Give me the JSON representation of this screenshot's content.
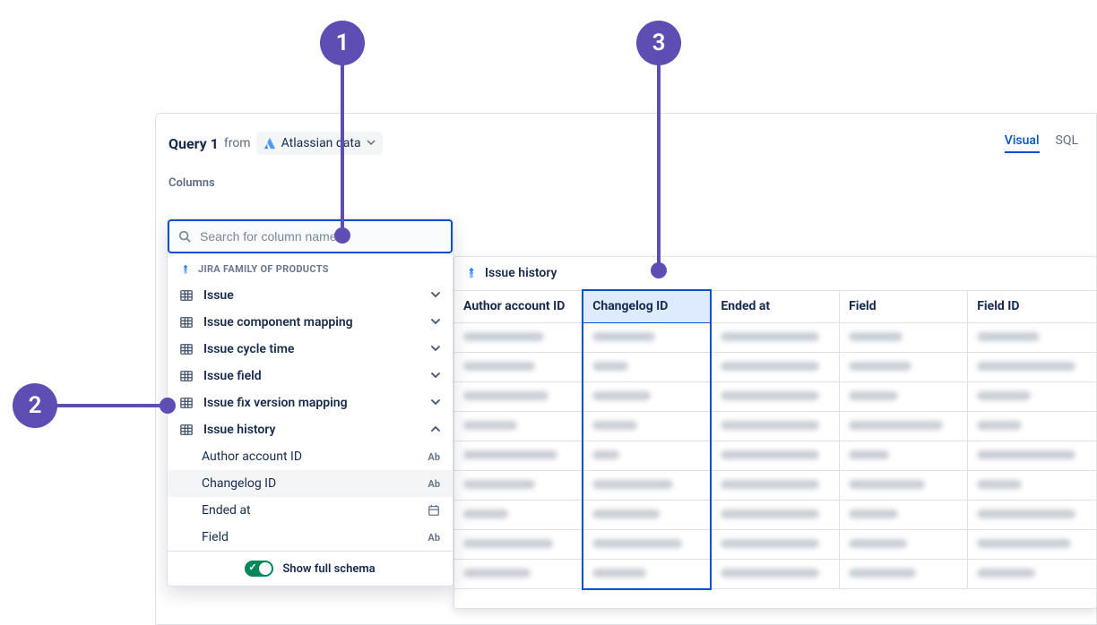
{
  "annotations": {
    "m1": "1",
    "m2": "2",
    "m3": "3"
  },
  "header": {
    "title": "Query 1",
    "from": "from",
    "dataSource": "Atlassian data",
    "tabs": {
      "visual": "Visual",
      "sql": "SQL"
    }
  },
  "columnsLabel": "Columns",
  "search": {
    "placeholder": "Search for column name"
  },
  "group": {
    "label": "JIRA FAMILY OF PRODUCTS"
  },
  "tables": [
    {
      "name": "Issue"
    },
    {
      "name": "Issue component mapping"
    },
    {
      "name": "Issue cycle time"
    },
    {
      "name": "Issue field"
    },
    {
      "name": "Issue fix version mapping"
    },
    {
      "name": "Issue history"
    }
  ],
  "subColumns": [
    {
      "name": "Author account ID",
      "type": "Ab"
    },
    {
      "name": "Changelog ID",
      "type": "Ab"
    },
    {
      "name": "Ended at",
      "type": "date"
    },
    {
      "name": "Field",
      "type": "Ab"
    }
  ],
  "footer": {
    "toggleLabel": "Show full schema"
  },
  "preview": {
    "title": "Issue history",
    "headers": [
      "Author account ID",
      "Changelog ID",
      "Ended at",
      "Field",
      "Field ID"
    ],
    "highlightIndex": 1,
    "rowCount": 9
  }
}
